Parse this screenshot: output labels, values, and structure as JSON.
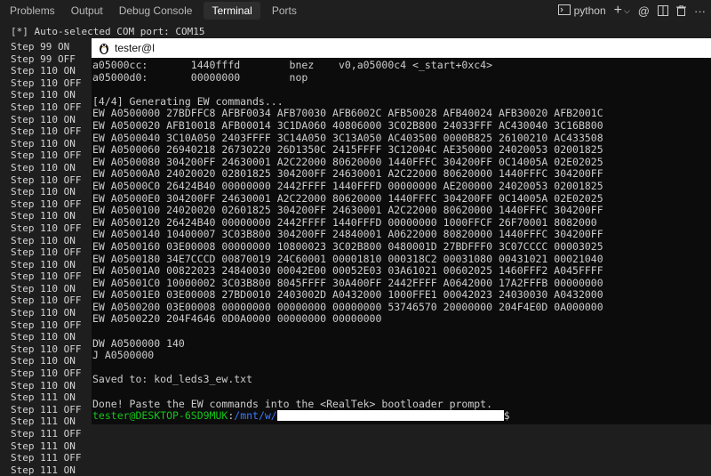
{
  "panel": {
    "tabs": [
      {
        "label": "Problems"
      },
      {
        "label": "Output"
      },
      {
        "label": "Debug Console"
      },
      {
        "label": "Terminal"
      },
      {
        "label": "Ports"
      }
    ],
    "active_tab": "Terminal",
    "terminal_label": "python",
    "icons": [
      "terminal-icon",
      "plus-icon",
      "chevron-down-icon",
      "at-icon",
      "split-icon",
      "trash-icon",
      "more-icon"
    ]
  },
  "outer_terminal": {
    "header": "[*] Auto-selected COM port: COM15",
    "steps": [
      "Step 99 ON",
      "Step 99 OFF",
      "Step 110 ON",
      "Step 110 OFF",
      "Step 110 ON",
      "Step 110 OFF",
      "Step 110 ON",
      "Step 110 OFF",
      "Step 110 ON",
      "Step 110 OFF",
      "Step 110 ON",
      "Step 110 OFF",
      "Step 110 ON",
      "Step 110 OFF",
      "Step 110 ON",
      "Step 110 OFF",
      "Step 110 ON",
      "Step 110 OFF",
      "Step 110 ON",
      "Step 110 OFF",
      "Step 110 ON",
      "Step 110 OFF",
      "Step 110 ON",
      "Step 110 OFF",
      "Step 110 ON",
      "Step 110 OFF",
      "Step 110 ON",
      "Step 110 OFF",
      "Step 110 ON",
      "Step 111 ON",
      "Step 111 OFF",
      "Step 111 ON",
      "Step 111 OFF",
      "Step 111 ON",
      "Step 111 OFF",
      "Step 111 ON"
    ]
  },
  "inner_window": {
    "title": "tester@l",
    "lines": [
      "a05000cc:       1440fffd        bnez    v0,a05000c4 <_start+0xc4>",
      "a05000d0:       00000000        nop",
      "",
      "[4/4] Generating EW commands...",
      "EW A0500000 27BDFFC8 AFBF0034 AFB70030 AFB6002C AFB50028 AFB40024 AFB30020 AFB2001C",
      "EW A0500020 AFB10018 AFB00014 3C1DA060 40806000 3C02B800 24033FFF AC430040 3C16B800",
      "EW A0500040 3C10A050 2403FFFF 3C14A050 3C13A050 AC403500 0000B825 26100210 AC433508",
      "EW A0500060 26940218 26730220 26D1350C 2415FFFF 3C12004C AE350000 24020053 02001825",
      "EW A0500080 304200FF 24630001 A2C22000 80620000 1440FFFC 304200FF 0C14005A 02E02025",
      "EW A05000A0 24020020 02801825 304200FF 24630001 A2C22000 80620000 1440FFFC 304200FF",
      "EW A05000C0 26424B40 00000000 2442FFFF 1440FFFD 00000000 AE200000 24020053 02001825",
      "EW A05000E0 304200FF 24630001 A2C22000 80620000 1440FFFC 304200FF 0C14005A 02E02025",
      "EW A0500100 24020020 02601825 304200FF 24630001 A2C22000 80620000 1440FFFC 304200FF",
      "EW A0500120 26424B40 00000000 2442FFFF 1440FFFD 00000000 1000FFCF 26F70001 8082000",
      "EW A0500140 10400007 3C03B800 304200FF 24840001 A0622000 80820000 1440FFFC 304200FF",
      "EW A0500160 03E00008 00000000 10800023 3C02B800 0480001D 27BDFFF0 3C07CCCC 00003025",
      "EW A0500180 34E7CCCD 00870019 24C60001 00001810 000318C2 00031080 00431021 00021040",
      "EW A05001A0 00822023 24840030 00042E00 00052E03 03A61021 00602025 1460FFF2 A045FFFF",
      "EW A05001C0 10000002 3C03B800 8045FFFF 30A400FF 2442FFFF A0642000 17A2FFFB 00000000",
      "EW A05001E0 03E00008 27BD0010 2403002D A0432000 1000FFE1 00042023 24030030 A0432000",
      "EW A0500200 03E00008 00000000 00000000 00000000 53746570 20000000 204F4E0D 0A000000",
      "EW A0500220 204F4646 0D0A0000 00000000 00000000",
      "",
      "DW A0500000 140",
      "J A0500000",
      "",
      "Saved to: kod_leds3_ew.txt",
      "",
      "Done! Paste the EW commands into the <RealTek> bootloader prompt."
    ],
    "prompt": {
      "user_host": "tester@DESKTOP-6SD9MUK",
      "separator": ":",
      "path": "/mnt/w/",
      "suffix": "$"
    }
  }
}
